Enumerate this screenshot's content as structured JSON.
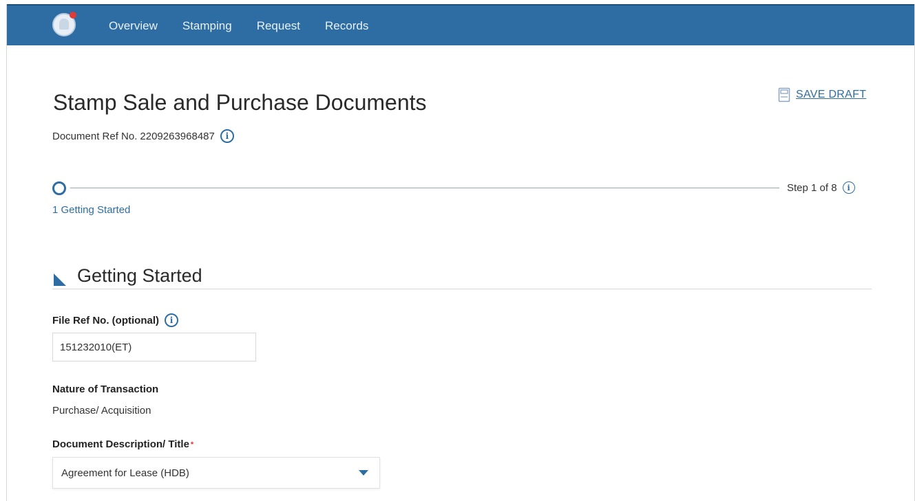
{
  "nav": {
    "items": [
      "Overview",
      "Stamping",
      "Request",
      "Records"
    ]
  },
  "page": {
    "title": "Stamp Sale and Purchase Documents",
    "save_draft": "SAVE DRAFT",
    "doc_ref_label": "Document Ref No.",
    "doc_ref_value": "2209263968487"
  },
  "stepper": {
    "step_count": "Step 1 of 8",
    "current_step_label": "1 Getting Started"
  },
  "section": {
    "title": "Getting Started"
  },
  "form": {
    "file_ref_label": "File Ref No. (optional)",
    "file_ref_value": "151232010(ET)",
    "nature_label": "Nature of Transaction",
    "nature_value": "Purchase/ Acquisition",
    "doc_desc_label": "Document Description/ Title",
    "doc_desc_required": "*",
    "doc_desc_value": "Agreement for Lease (HDB)"
  },
  "icons": {
    "logo": "notification-bell-icon",
    "save": "save-draft-icon",
    "info": "info-icon",
    "caret": "chevron-down-icon"
  },
  "colors": {
    "navbar": "#2d6da3",
    "accent": "#2d6da3",
    "required": "#dd3333"
  }
}
